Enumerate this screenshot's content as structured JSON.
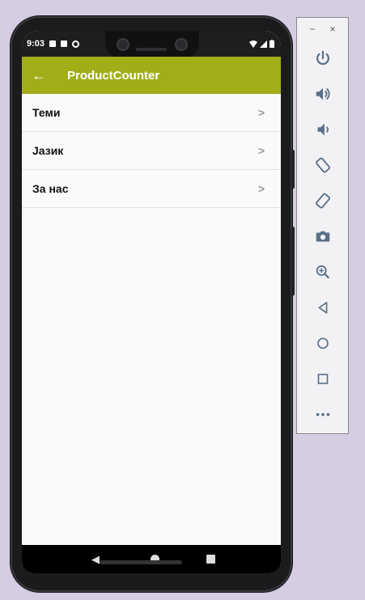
{
  "status_bar": {
    "time": "9:03"
  },
  "app_bar": {
    "back_icon": "←",
    "title": "ProductCounter"
  },
  "menu": {
    "items": [
      {
        "label": "Теми",
        "chevron": ">"
      },
      {
        "label": "Јазик",
        "chevron": ">"
      },
      {
        "label": "За нас",
        "chevron": ">"
      }
    ]
  },
  "nav": {
    "back": "◀"
  },
  "emulator": {
    "minimize": "−",
    "close": "×",
    "tools": [
      "power-icon",
      "volume-up-icon",
      "volume-down-icon",
      "rotate-left-icon",
      "rotate-right-icon",
      "camera-icon",
      "zoom-icon",
      "back-icon",
      "home-icon",
      "overview-icon",
      "more-icon"
    ]
  },
  "colors": {
    "accent": "#a3ad18",
    "background": "#d6cde3"
  }
}
